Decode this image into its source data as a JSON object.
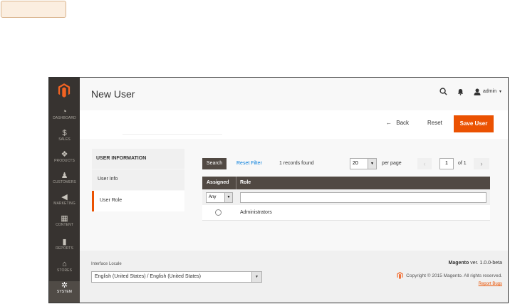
{
  "colors": {
    "accent": "#eb5202",
    "sidebar_bg": "#373330",
    "grid_header": "#514943"
  },
  "sidebar": {
    "logo_icon": "magento-logo-icon",
    "items": [
      {
        "label": "DASHBOARD",
        "icon": "dashboard-icon",
        "glyph": "◔"
      },
      {
        "label": "SALES",
        "icon": "dollar-icon",
        "glyph": "$"
      },
      {
        "label": "PRODUCTS",
        "icon": "cube-icon",
        "glyph": "❖"
      },
      {
        "label": "CUSTOMERS",
        "icon": "person-icon",
        "glyph": "♟"
      },
      {
        "label": "MARKETING",
        "icon": "megaphone-icon",
        "glyph": "◀"
      },
      {
        "label": "CONTENT",
        "icon": "content-icon",
        "glyph": "▦"
      },
      {
        "label": "REPORTS",
        "icon": "bar-chart-icon",
        "glyph": "▮"
      },
      {
        "label": "STORES",
        "icon": "store-icon",
        "glyph": "⌂"
      },
      {
        "label": "SYSTEM",
        "icon": "gear-icon",
        "glyph": "✲"
      }
    ]
  },
  "header": {
    "title": "New User",
    "user": "admin"
  },
  "actions": {
    "back": "Back",
    "reset": "Reset",
    "save": "Save User"
  },
  "tabs": {
    "heading": "USER INFORMATION",
    "items": [
      "User Info",
      "User Role"
    ]
  },
  "grid": {
    "search": "Search",
    "reset_filter": "Reset Filter",
    "records": "1 records found",
    "per_page_value": "20",
    "per_page_label": "per page",
    "page": "1",
    "of": "of 1",
    "columns": [
      "Assigned",
      "Role"
    ],
    "filter_any": "Any",
    "rows": [
      {
        "role": "Administrators"
      }
    ]
  },
  "footer": {
    "locale_label": "Interface Locale",
    "locale_value": "English (United States) / English (United States)",
    "brand": "Magento",
    "version": " ver. 1.0.0-beta",
    "copyright": "Copyright © 2015 Magento. All rights reserved.",
    "report": "Report Bugs"
  }
}
